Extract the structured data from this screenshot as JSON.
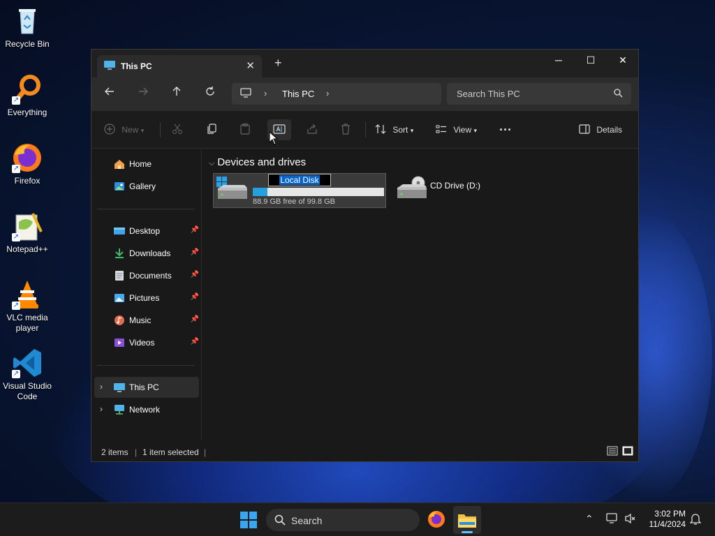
{
  "desktop": {
    "icons": [
      {
        "label": "Recycle Bin",
        "icon": "recycle-bin-icon"
      },
      {
        "label": "Everything",
        "icon": "everything-icon"
      },
      {
        "label": "Firefox",
        "icon": "firefox-icon"
      },
      {
        "label": "Notepad++",
        "icon": "notepadpp-icon"
      },
      {
        "label": "VLC media player",
        "icon": "vlc-icon"
      },
      {
        "label": "Visual Studio Code",
        "icon": "vscode-icon"
      }
    ]
  },
  "window": {
    "tab_title": "This PC",
    "new_tab": "+",
    "controls": {
      "minimize": "─",
      "maximize": "☐",
      "close": "✕"
    }
  },
  "navbar": {
    "breadcrumb": "This PC",
    "search_placeholder": "Search This PC"
  },
  "commandbar": {
    "new_label": "New",
    "sort_label": "Sort",
    "view_label": "View",
    "details_label": "Details"
  },
  "navpane": {
    "top": [
      {
        "label": "Home",
        "icon": "home-icon"
      },
      {
        "label": "Gallery",
        "icon": "gallery-icon"
      }
    ],
    "pinned": [
      {
        "label": "Desktop",
        "icon": "desktop-folder-icon"
      },
      {
        "label": "Downloads",
        "icon": "downloads-icon"
      },
      {
        "label": "Documents",
        "icon": "documents-icon"
      },
      {
        "label": "Pictures",
        "icon": "pictures-icon"
      },
      {
        "label": "Music",
        "icon": "music-icon"
      },
      {
        "label": "Videos",
        "icon": "videos-icon"
      }
    ],
    "bottom": [
      {
        "label": "This PC",
        "icon": "this-pc-icon",
        "selected": true
      },
      {
        "label": "Network",
        "icon": "network-icon",
        "selected": false
      }
    ]
  },
  "content": {
    "group_title": "Devices and drives",
    "drives": [
      {
        "name": "Local Disk",
        "free_text": "88.9 GB free of 99.8 GB",
        "used_fraction": 0.11,
        "renaming": true
      },
      {
        "name": "CD Drive (D:)"
      }
    ]
  },
  "status": {
    "items": "2 items",
    "selected": "1 item selected"
  },
  "taskbar": {
    "search_placeholder": "Search",
    "time": "3:02 PM",
    "date": "11/4/2024"
  },
  "colors": {
    "accent": "#26a0da",
    "selection": "#0a64c8",
    "window_bg": "#191919"
  }
}
